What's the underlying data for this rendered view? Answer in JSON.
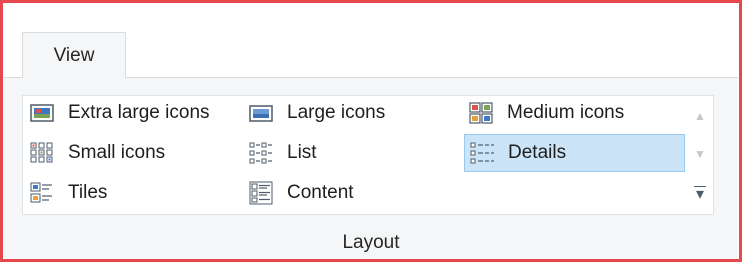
{
  "tabs": [
    {
      "label": "View"
    }
  ],
  "layout_group": {
    "label": "Layout",
    "items": [
      {
        "label": "Extra large icons",
        "icon": "extra-large-icons-icon",
        "selected": false
      },
      {
        "label": "Large icons",
        "icon": "large-icons-icon",
        "selected": false
      },
      {
        "label": "Medium icons",
        "icon": "medium-icons-icon",
        "selected": false
      },
      {
        "label": "Small icons",
        "icon": "small-icons-icon",
        "selected": false
      },
      {
        "label": "List",
        "icon": "list-icon",
        "selected": false
      },
      {
        "label": "Details",
        "icon": "details-icon",
        "selected": true
      },
      {
        "label": "Tiles",
        "icon": "tiles-icon",
        "selected": false
      },
      {
        "label": "Content",
        "icon": "content-icon",
        "selected": false
      }
    ]
  },
  "scroll": {
    "up": "▲",
    "down": "▼",
    "more": "▾"
  },
  "colors": {
    "frame_border": "#e5484d",
    "ribbon_bg": "#f5f6f7",
    "selected_bg": "#cce4f7",
    "selected_border": "#99c9ef"
  }
}
